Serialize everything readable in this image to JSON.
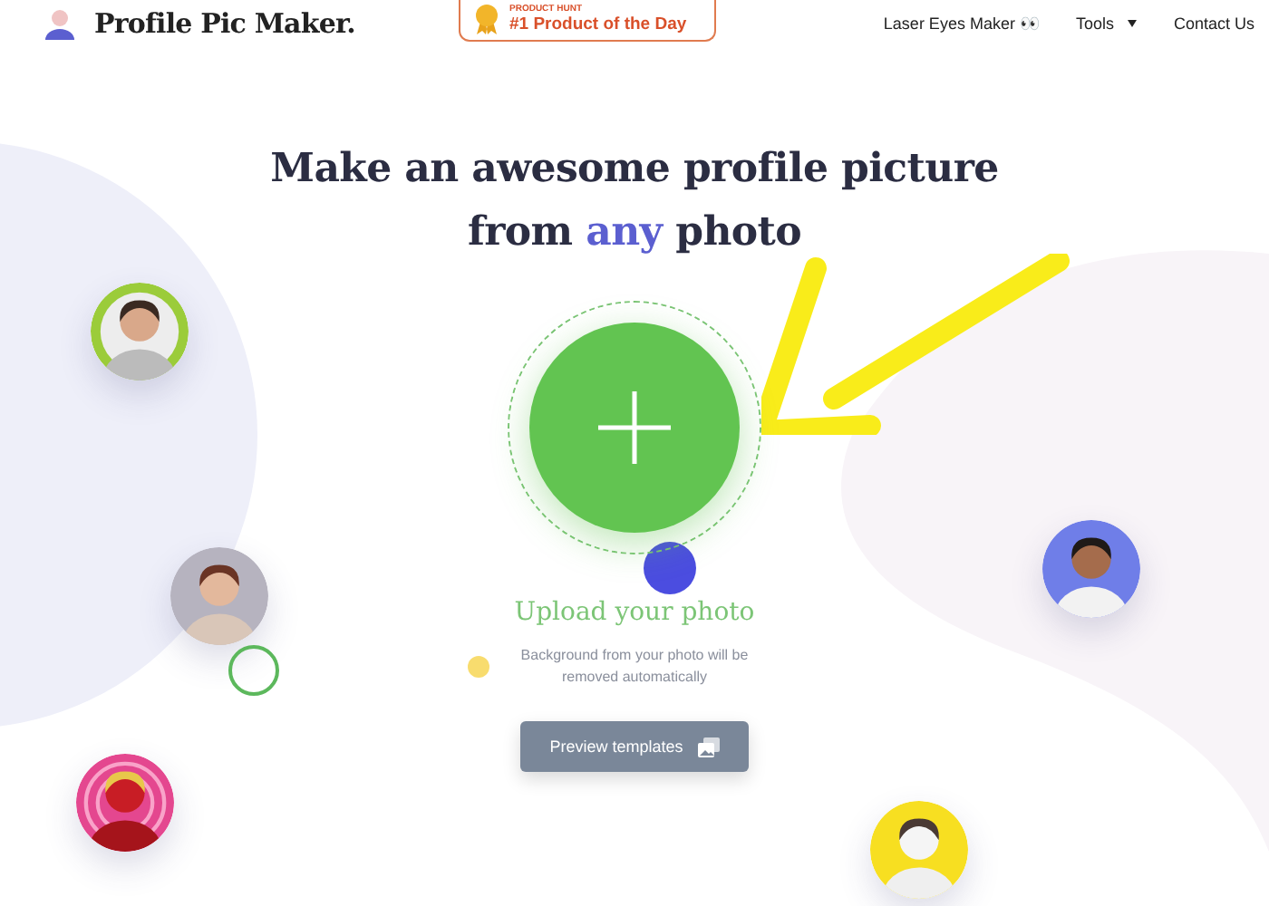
{
  "header": {
    "logo": "Profile Pic Maker.",
    "badge": {
      "eyebrow": "PRODUCT HUNT",
      "title": "#1 Product of the Day"
    },
    "nav": [
      {
        "label": "Laser Eyes Maker 👀",
        "kind": "link"
      },
      {
        "label": "Tools",
        "kind": "dropdown"
      },
      {
        "label": "Contact Us",
        "kind": "link"
      }
    ]
  },
  "hero": {
    "title_start": "Make an awesome profile picture from",
    "title_highlight": "any",
    "title_end": "photo"
  },
  "upload": {
    "label": "Upload your photo",
    "note": "Background from your photo will be removed automatically"
  },
  "preview_button": {
    "label": "Preview templates"
  }
}
